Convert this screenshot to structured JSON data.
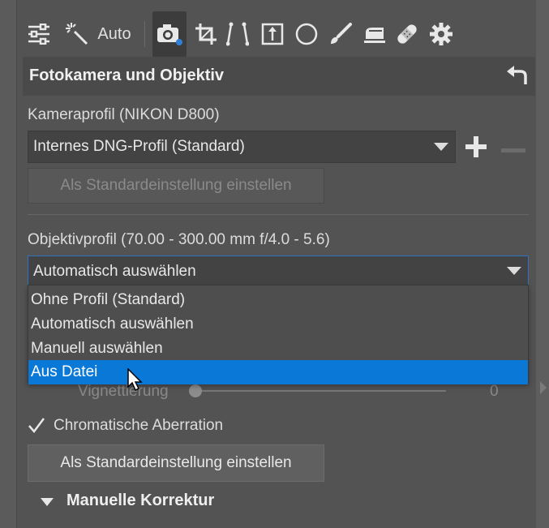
{
  "toolbar": {
    "auto_label": "Auto",
    "icons": [
      "sliders-icon",
      "magic-wand-icon",
      "camera-icon",
      "crop-icon",
      "perspective-icon",
      "export-icon",
      "circle-icon",
      "brush-icon",
      "stack-icon",
      "bandage-icon",
      "gear-icon"
    ],
    "active": "camera-icon"
  },
  "section": {
    "title": "Fotokamera und Objektiv"
  },
  "camera": {
    "profile_label": "Kameraprofil (NIKON D800)",
    "profile_value": "Internes DNG-Profil (Standard)",
    "default_button": "Als Standardeinstellung einstellen"
  },
  "lens": {
    "profile_label": "Objektivprofil (70.00 - 300.00 mm f/4.0 - 5.6)",
    "profile_value": "Automatisch auswählen",
    "options": [
      "Ohne Profil (Standard)",
      "Automatisch auswählen",
      "Manuell auswählen",
      "Aus Datei"
    ],
    "highlighted_option": "Aus Datei"
  },
  "vignetting": {
    "label": "Vignettierung",
    "value": "0"
  },
  "chromatic": {
    "label": "Chromatische Aberration",
    "checked": true,
    "default_button": "Als Standardeinstellung einstellen"
  },
  "manual": {
    "title": "Manuelle Korrektur"
  },
  "colors": {
    "accent": "#0a78d7",
    "panel": "#535353"
  }
}
